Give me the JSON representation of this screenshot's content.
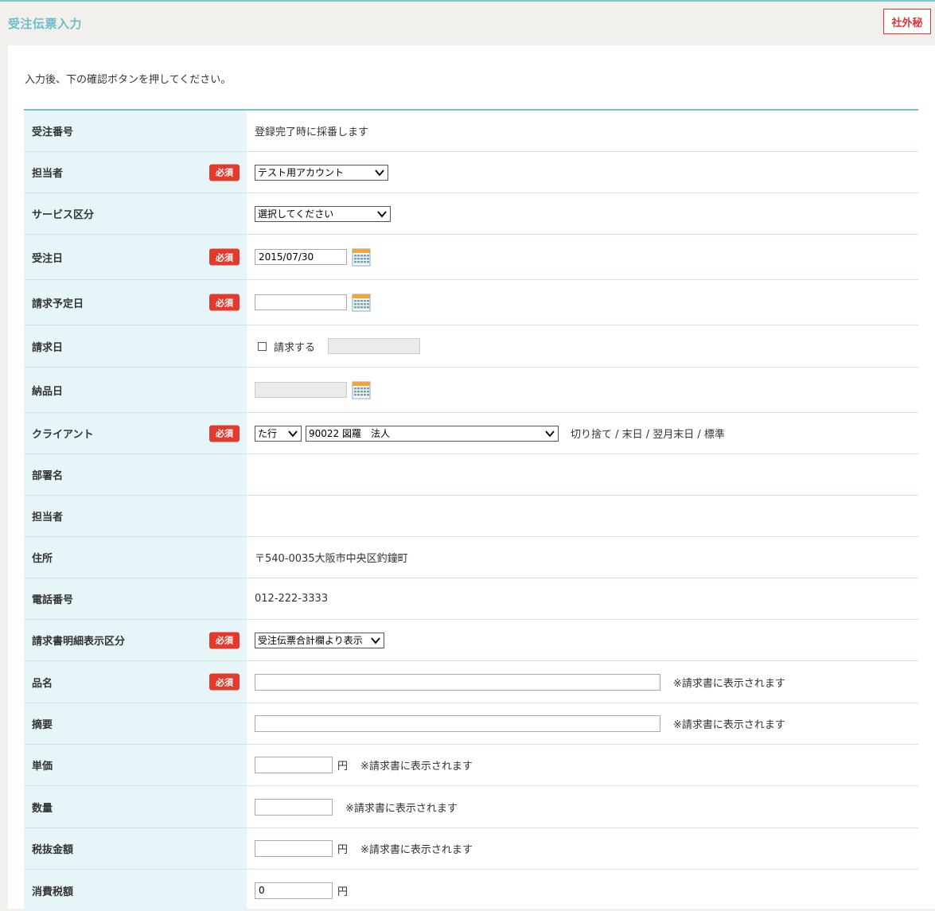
{
  "header": {
    "title": "受注伝票入力",
    "secret_badge": "社外秘"
  },
  "instruction": "入力後、下の確認ボタンを押してください。",
  "required_label": "必須",
  "rows": {
    "order_no": {
      "label": "受注番号",
      "value": "登録完了時に採番します"
    },
    "staff": {
      "label": "担当者",
      "selected": "テスト用アカウント"
    },
    "service": {
      "label": "サービス区分",
      "selected": "選択してください"
    },
    "order_date": {
      "label": "受注日",
      "value": "2015/07/30"
    },
    "billing_plan_date": {
      "label": "請求予定日",
      "value": ""
    },
    "billing_date": {
      "label": "請求日",
      "checkbox_label": "請求する",
      "value": ""
    },
    "delivery_date": {
      "label": "納品日",
      "value": ""
    },
    "client": {
      "label": "クライアント",
      "kana_selected": "た行",
      "client_selected": "90022 図羅　法人",
      "terms": "切り捨て / 末日 / 翌月末日 / 標準"
    },
    "department": {
      "label": "部署名",
      "value": ""
    },
    "contact": {
      "label": "担当者",
      "value": ""
    },
    "address": {
      "label": "住所",
      "value": "〒540-0035大阪市中央区釣鐘町"
    },
    "phone": {
      "label": "電話番号",
      "value": "012-222-3333"
    },
    "invoice_detail": {
      "label": "請求書明細表示区分",
      "selected": "受注伝票合計欄より表示"
    },
    "item_name": {
      "label": "品名",
      "value": "",
      "note": "※請求書に表示されます"
    },
    "summary": {
      "label": "摘要",
      "value": "",
      "note": "※請求書に表示されます"
    },
    "unit_price": {
      "label": "単価",
      "value": "",
      "unit": "円",
      "note": "※請求書に表示されます"
    },
    "quantity": {
      "label": "数量",
      "value": "",
      "note": "※請求書に表示されます"
    },
    "amount_ex_tax": {
      "label": "税抜金額",
      "value": "",
      "unit": "円",
      "note": "※請求書に表示されます"
    },
    "consumption_tax": {
      "label": "消費税額",
      "value": "0",
      "unit": "円"
    }
  }
}
